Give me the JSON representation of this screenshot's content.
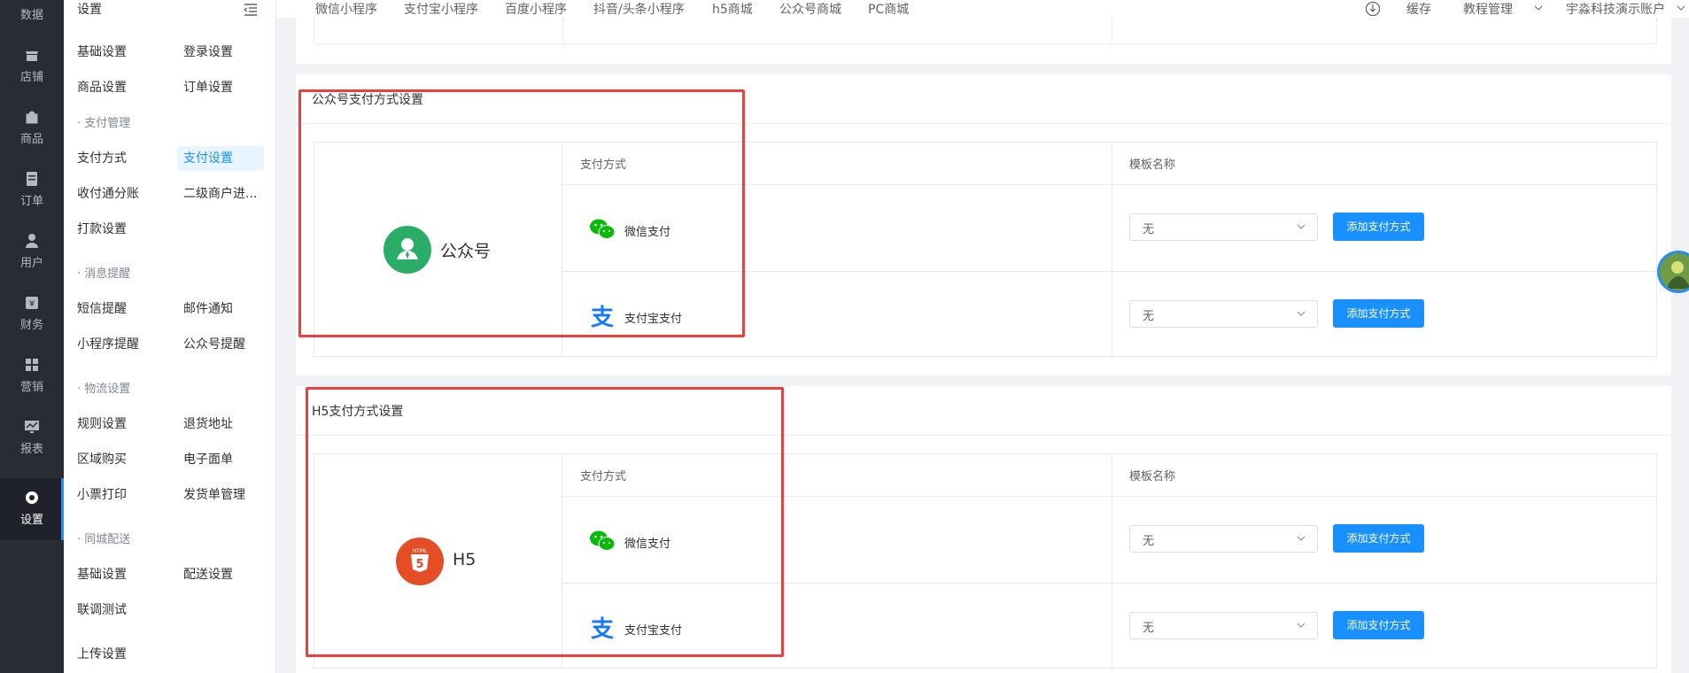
{
  "rail": {
    "items": [
      {
        "label": "数据",
        "icon": "data-icon"
      },
      {
        "label": "店铺",
        "icon": "store-icon"
      },
      {
        "label": "商品",
        "icon": "goods-icon"
      },
      {
        "label": "订单",
        "icon": "order-icon"
      },
      {
        "label": "用户",
        "icon": "user-icon"
      },
      {
        "label": "财务",
        "icon": "finance-icon"
      },
      {
        "label": "营销",
        "icon": "marketing-icon"
      },
      {
        "label": "报表",
        "icon": "report-icon"
      },
      {
        "label": "设置",
        "icon": "settings-icon",
        "active": true
      }
    ]
  },
  "submenu": {
    "title": "设置",
    "items": {
      "basic": "基础设置",
      "login": "登录设置",
      "goods": "商品设置",
      "order": "订单设置",
      "group_pay": "· 支付管理",
      "pay_method": "支付方式",
      "pay_settings": "支付设置",
      "split": "收付通分账",
      "sub_merchant": "二级商户进...",
      "payout": "打款设置",
      "group_msg": "· 消息提醒",
      "sms": "短信提醒",
      "mail": "邮件通知",
      "mini_remind": "小程序提醒",
      "mp_remind": "公众号提醒",
      "group_logistics": "· 物流设置",
      "rule": "规则设置",
      "return_addr": "退货地址",
      "region": "区域购买",
      "e_sheet": "电子面单",
      "receipt": "小票打印",
      "ship_mgmt": "发货单管理",
      "group_city": "· 同城配送",
      "city_basic": "基础设置",
      "delivery": "配送设置",
      "joint_test": "联调测试",
      "upload": "上传设置"
    }
  },
  "topnav": {
    "links": [
      "微信小程序",
      "支付宝小程序",
      "百度小程序",
      "抖音/头条小程序",
      "h5商城",
      "公众号商城",
      "PC商城"
    ],
    "cache": "缓存",
    "tutorial": "教程管理",
    "account": "宇淼科技演示账户"
  },
  "sections": [
    {
      "title": "公众号支付方式设置",
      "brand": "公众号",
      "col_method": "支付方式",
      "col_template": "模板名称",
      "rows": [
        {
          "method": "微信支付",
          "template": "无",
          "button": "添加支付方式"
        },
        {
          "method": "支付宝支付",
          "template": "无",
          "button": "添加支付方式"
        }
      ]
    },
    {
      "title": "H5支付方式设置",
      "brand": "H5",
      "col_method": "支付方式",
      "col_template": "模板名称",
      "rows": [
        {
          "method": "微信支付",
          "template": "无",
          "button": "添加支付方式"
        },
        {
          "method": "支付宝支付",
          "template": "无",
          "button": "添加支付方式"
        }
      ]
    }
  ],
  "colors": {
    "primary": "#1890ff",
    "highlight": "#ef3e3e",
    "wechat": "#09bb07",
    "alipay": "#1677ff",
    "mp_brand": "#2aae67",
    "h5_brand": "#e44d26"
  }
}
